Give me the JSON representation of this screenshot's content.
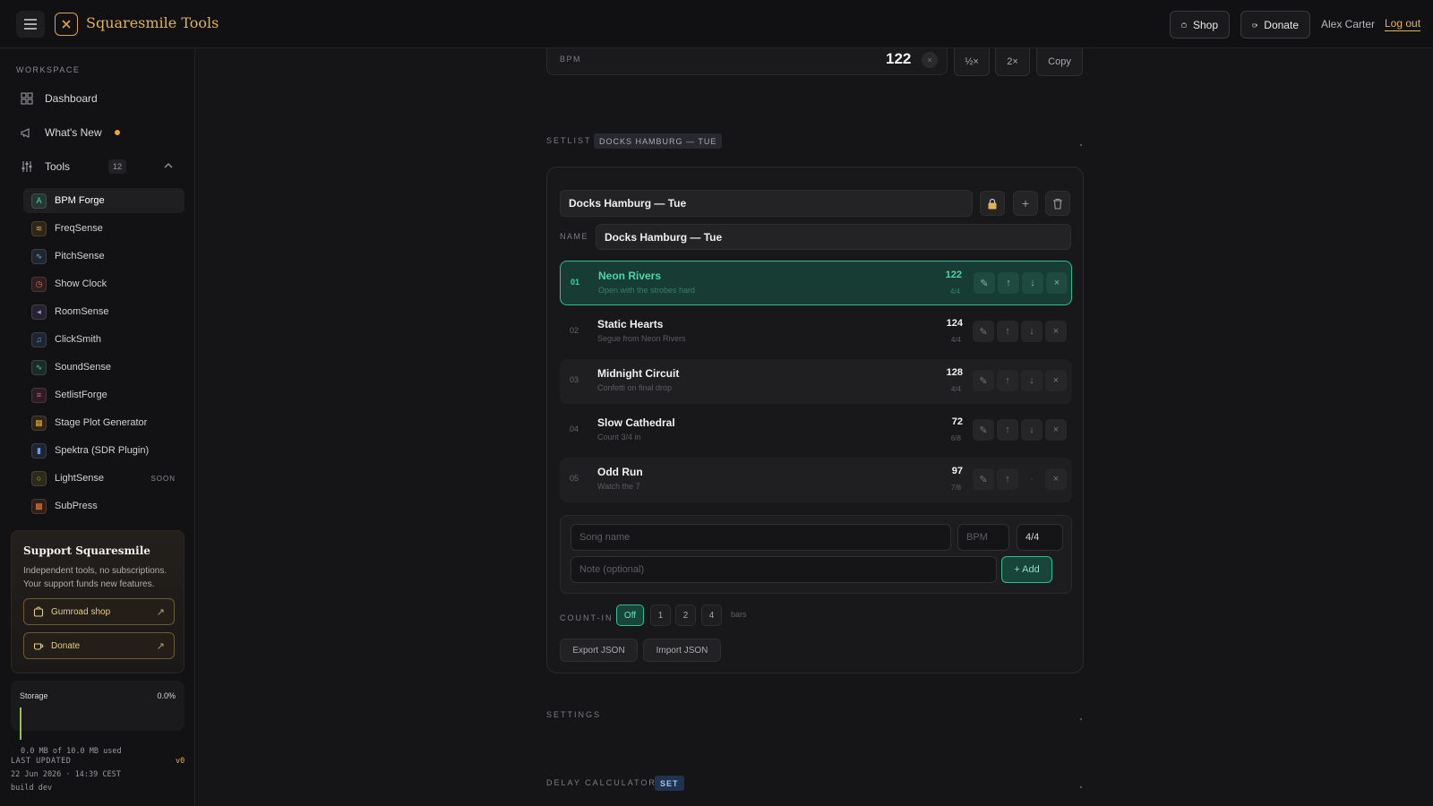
{
  "header": {
    "brand": "Squaresmile Tools",
    "shop_label": "Shop",
    "donate_label": "Donate",
    "user_name": "Alex Carter",
    "logout_label": "Log out"
  },
  "sidebar": {
    "workspace_label": "WORKSPACE",
    "nav": [
      {
        "label": "Dashboard",
        "icon": "dashboard-icon"
      },
      {
        "label": "What's New",
        "icon": "megaphone-icon"
      },
      {
        "label": "Tools",
        "icon": "sliders-icon",
        "count": "12"
      }
    ],
    "tools": [
      {
        "label": "BPM Forge",
        "glyph": "A",
        "color": "#4fd6a5"
      },
      {
        "label": "FreqSense",
        "glyph": "≋",
        "color": "#e8a83b"
      },
      {
        "label": "PitchSense",
        "glyph": "∿",
        "color": "#6fb6e8"
      },
      {
        "label": "Show Clock",
        "glyph": "◷",
        "color": "#e8735a"
      },
      {
        "label": "RoomSense",
        "glyph": "◂",
        "color": "#a98ce8"
      },
      {
        "label": "ClickSmith",
        "glyph": "♫",
        "color": "#6f9ce8"
      },
      {
        "label": "SoundSense",
        "glyph": "∿",
        "color": "#4fd6a5"
      },
      {
        "label": "SetlistForge",
        "glyph": "≡",
        "color": "#e85a8c"
      },
      {
        "label": "Stage Plot Generator",
        "glyph": "▦",
        "color": "#e8a83b"
      },
      {
        "label": "Spektra (SDR Plugin)",
        "glyph": "▮",
        "color": "#6f9ce8"
      },
      {
        "label": "LightSense",
        "glyph": "○",
        "color": "#d8c84a",
        "badge": "SOON"
      },
      {
        "label": "SubPress",
        "glyph": "▩",
        "color": "#e8803b"
      }
    ],
    "support": {
      "title": "Support Squaresmile",
      "text": "Independent tools, no subscriptions. Your support funds new features.",
      "gumroad_label": "Gumroad shop",
      "donate_label": "Donate"
    },
    "storage": {
      "label": "Storage",
      "percent": "0.0%",
      "used_text": "0.0 MB of 10.0 MB used",
      "fill_fraction": 0.0
    },
    "footer": {
      "last_updated_label": "LAST UPDATED",
      "version": "v0",
      "timestamp": "22 Jun 2026 · 14:39 CEST",
      "build": "build dev"
    }
  },
  "bpm": {
    "label": "BPM",
    "value": "122",
    "half_label": "½×",
    "double_label": "2×",
    "copy_label": "Copy"
  },
  "setlist": {
    "section_label": "SETLIST",
    "tag": "DOCKS HAMBURG — TUE",
    "selected": "Docks Hamburg — Tue",
    "name_label": "NAME",
    "name_value": "Docks Hamburg — Tue",
    "songs": [
      {
        "num": "01",
        "title": "Neon Rivers",
        "note": "Open with the strobes hard",
        "bpm": "122",
        "ts": "4/4",
        "active": true
      },
      {
        "num": "02",
        "title": "Static Hearts",
        "note": "Segue from Neon Rivers",
        "bpm": "124",
        "ts": "4/4"
      },
      {
        "num": "03",
        "title": "Midnight Circuit",
        "note": "Confetti on final drop",
        "bpm": "128",
        "ts": "4/4"
      },
      {
        "num": "04",
        "title": "Slow Cathedral",
        "note": "Count 3/4 in",
        "bpm": "72",
        "ts": "6/8"
      },
      {
        "num": "05",
        "title": "Odd Run",
        "note": "Watch the 7",
        "bpm": "97",
        "ts": "7/8"
      }
    ],
    "add": {
      "song_placeholder": "Song name",
      "bpm_placeholder": "BPM",
      "ts_value": "4/4",
      "note_placeholder": "Note (optional)",
      "add_label": "+ Add"
    },
    "count_in": {
      "label": "COUNT-IN",
      "options": [
        "Off",
        "1",
        "2",
        "4"
      ],
      "selected": "Off",
      "unit": "bars"
    },
    "export_label": "Export JSON",
    "import_label": "Import JSON"
  },
  "settings": {
    "section_label": "SETTINGS"
  },
  "delay": {
    "section_label": "DELAY CALCULATOR",
    "tag": "SET"
  }
}
